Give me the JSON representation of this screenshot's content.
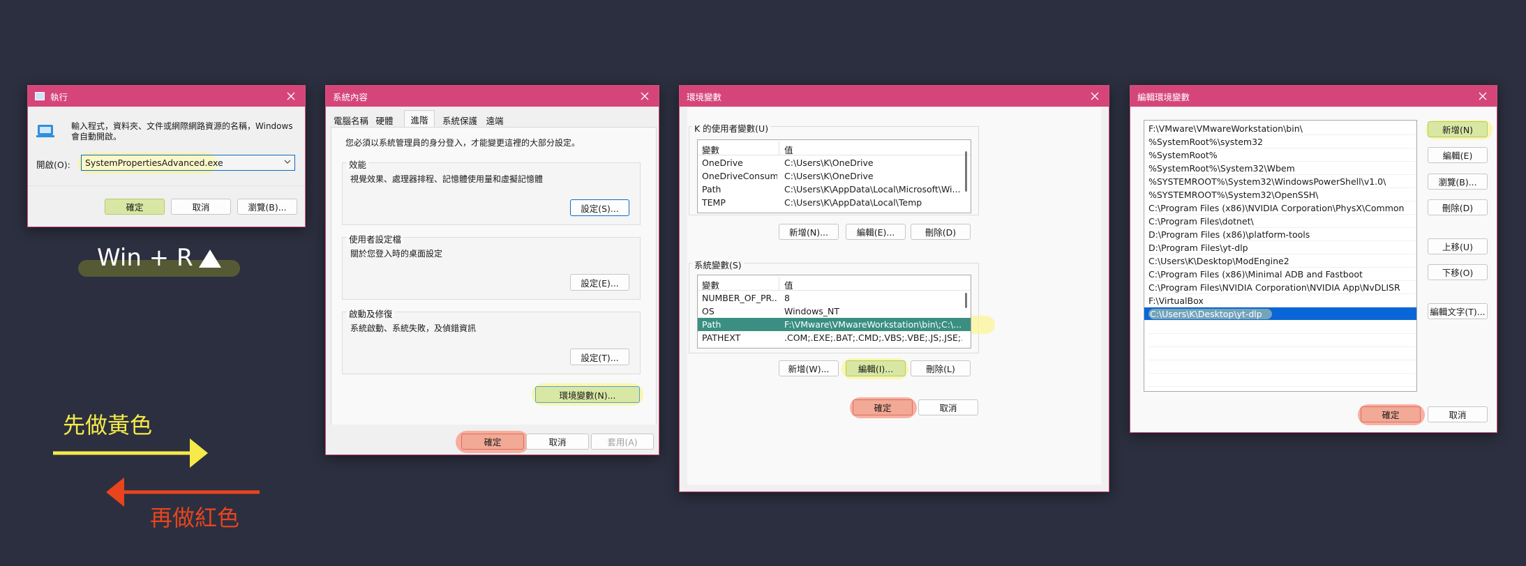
{
  "run_dialog": {
    "title": "執行",
    "description": "輸入程式，資料夾、文件或網際網路資源的名稱，Windows 會自動開啟。",
    "open_label": "開啟(O):",
    "input_value": "SystemPropertiesAdvanced.exe",
    "ok_label": "確定",
    "cancel_label": "取消",
    "browse_label": "瀏覽(B)..."
  },
  "hotkey_label": "Win + R",
  "sysprops_dialog": {
    "title": "系統內容",
    "tabs": [
      "電腦名稱",
      "硬體",
      "進階",
      "系統保護",
      "遠端"
    ],
    "active_tab": "進階",
    "admin_note": "您必須以系統管理員的身分登入，才能變更這裡的大部分設定。",
    "performance": {
      "title": "效能",
      "desc": "視覺效果、處理器排程、記憶體使用量和虛擬記憶體",
      "button": "設定(S)..."
    },
    "user_profiles": {
      "title": "使用者設定檔",
      "desc": "關於您登入時的桌面設定",
      "button": "設定(E)..."
    },
    "startup": {
      "title": "啟動及修復",
      "desc": "系統啟動、系統失敗，及偵錯資訊",
      "button": "設定(T)..."
    },
    "env_button": "環境變數(N)...",
    "ok_label": "確定",
    "cancel_label": "取消",
    "apply_label": "套用(A)"
  },
  "env_dialog": {
    "title": "環境變數",
    "user_group_title": "K 的使用者變數(U)",
    "col_var": "變數",
    "col_value": "值",
    "user_vars": [
      {
        "name": "OneDrive",
        "value": "C:\\Users\\K\\OneDrive"
      },
      {
        "name": "OneDriveConsum...",
        "value": "C:\\Users\\K\\OneDrive"
      },
      {
        "name": "Path",
        "value": "C:\\Users\\K\\AppData\\Local\\Microsoft\\Wi..."
      },
      {
        "name": "TEMP",
        "value": "C:\\Users\\K\\AppData\\Local\\Temp"
      }
    ],
    "user_buttons": {
      "new": "新增(N)...",
      "edit": "編輯(E)...",
      "delete": "刪除(D)"
    },
    "system_group_title": "系統變數(S)",
    "system_vars": [
      {
        "name": "NUMBER_OF_PR...",
        "value": "8"
      },
      {
        "name": "OS",
        "value": "Windows_NT"
      },
      {
        "name": "Path",
        "value": "F:\\VMware\\VMwareWorkstation\\bin\\;C:\\..."
      },
      {
        "name": "PATHEXT",
        "value": ".COM;.EXE;.BAT;.CMD;.VBS;.VBE;.JS;.JSE;..."
      }
    ],
    "system_buttons": {
      "new": "新增(W)...",
      "edit": "編輯(I)...",
      "delete": "刪除(L)"
    },
    "ok_label": "確定",
    "cancel_label": "取消"
  },
  "edit_env_dialog": {
    "title": "編輯環境變數",
    "entries": [
      "F:\\VMware\\VMwareWorkstation\\bin\\",
      "%SystemRoot%\\system32",
      "%SystemRoot%",
      "%SystemRoot%\\System32\\Wbem",
      "%SYSTEMROOT%\\System32\\WindowsPowerShell\\v1.0\\",
      "%SYSTEMROOT%\\System32\\OpenSSH\\",
      "C:\\Program Files (x86)\\NVIDIA Corporation\\PhysX\\Common",
      "C:\\Program Files\\dotnet\\",
      "D:\\Program Files (x86)\\platform-tools",
      "D:\\Program Files\\yt-dlp",
      "C:\\Users\\K\\Desktop\\ModEngine2",
      "C:\\Program Files (x86)\\Minimal ADB and Fastboot",
      "C:\\Program Files\\NVIDIA Corporation\\NVIDIA App\\NvDLISR",
      "F:\\VirtualBox",
      "C:\\Users\\K\\Desktop\\yt-dlp"
    ],
    "selected_entry": "C:\\Users\\K\\Desktop\\yt-dlp",
    "buttons": {
      "new": "新增(N)",
      "edit": "編輯(E)",
      "browse": "瀏覽(B)...",
      "delete": "刪除(D)",
      "up": "上移(U)",
      "down": "下移(O)",
      "edit_text": "編輯文字(T)..."
    },
    "ok_label": "確定",
    "cancel_label": "取消"
  },
  "legend": {
    "yellow_text": "先做黃色",
    "red_text": "再做紅色",
    "yellow_color": "#f5ea4a",
    "red_color": "#e8441e"
  }
}
